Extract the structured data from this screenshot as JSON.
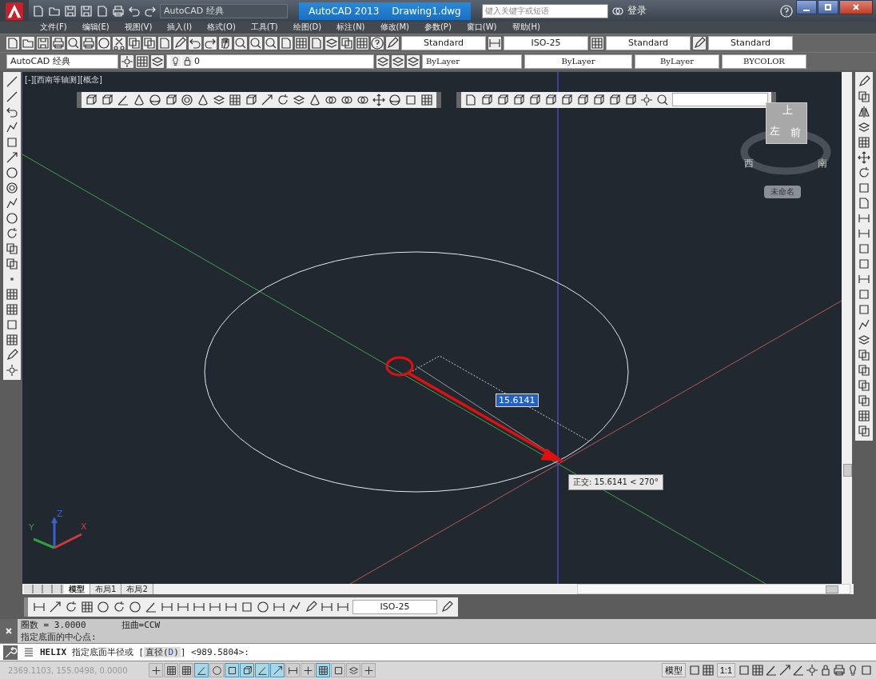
{
  "title_bar": {
    "workspace": "AutoCAD 经典",
    "app_title": "AutoCAD 2013",
    "document": "Drawing1.dwg",
    "search": {
      "placeholder": "键入关键字或短语"
    },
    "sign_in": "登录"
  },
  "menu_bar": [
    "文件(F)",
    "编辑(E)",
    "视图(V)",
    "插入(I)",
    "格式(O)",
    "工具(T)",
    "绘图(D)",
    "标注(N)",
    "修改(M)",
    "参数(P)",
    "窗口(W)",
    "帮助(H)"
  ],
  "styles_toolbar": {
    "text_style": "Standard",
    "dim_style": "ISO-25",
    "table_style": "Standard",
    "multileader_style": "Standard"
  },
  "properties_toolbar": {
    "workspace": "AutoCAD 经典",
    "layer": "0",
    "layer_color": "ByLayer",
    "linetype": "ByLayer",
    "lineweight": "ByLayer",
    "plot_style": "BYCOLOR"
  },
  "viewport": {
    "label": "[-][西南等轴测][概念]",
    "viewcube": {
      "top": "上",
      "left": "左",
      "front": "前",
      "west": "西",
      "south": "南",
      "ucs_menu": "未命名"
    },
    "dynamic_input": "15.6141",
    "tooltip": "正交: 15.6141 < 270°",
    "ucs": {
      "x": "X",
      "y": "Y",
      "z": "Z"
    }
  },
  "layout_tabs": [
    {
      "label": "模型",
      "selected": true
    },
    {
      "label": "布局1",
      "selected": false
    },
    {
      "label": "布局2",
      "selected": false
    }
  ],
  "dim_toolbar": {
    "dim_style": "ISO-25"
  },
  "command_history": [
    [
      "圈数 = 3.0000",
      "扭曲=CCW"
    ],
    [
      "指定底面的中心点:"
    ]
  ],
  "command_line": [
    {
      "kind": "command",
      "text": "HELIX"
    },
    {
      "kind": "plain",
      "text": "指定底面半径或 ["
    },
    {
      "kind": "option",
      "text": "直径(",
      "key": "D",
      "end": ")"
    },
    {
      "kind": "plain",
      "text": "] <989.5804>:"
    }
  ],
  "status_bar": {
    "coordinates": "2369.1103, 155.0498, 0.0000",
    "toggles": [
      {
        "on": false
      },
      {
        "on": false
      },
      {
        "on": false
      },
      {
        "on": true
      },
      {
        "on": false
      },
      {
        "on": true
      },
      {
        "on": true
      },
      {
        "on": true
      },
      {
        "on": true
      },
      {
        "on": false
      },
      {
        "on": false
      },
      {
        "on": true
      },
      {
        "on": false
      },
      {
        "on": false
      },
      {
        "on": false
      }
    ],
    "model": "模型",
    "scale": "1:1"
  }
}
